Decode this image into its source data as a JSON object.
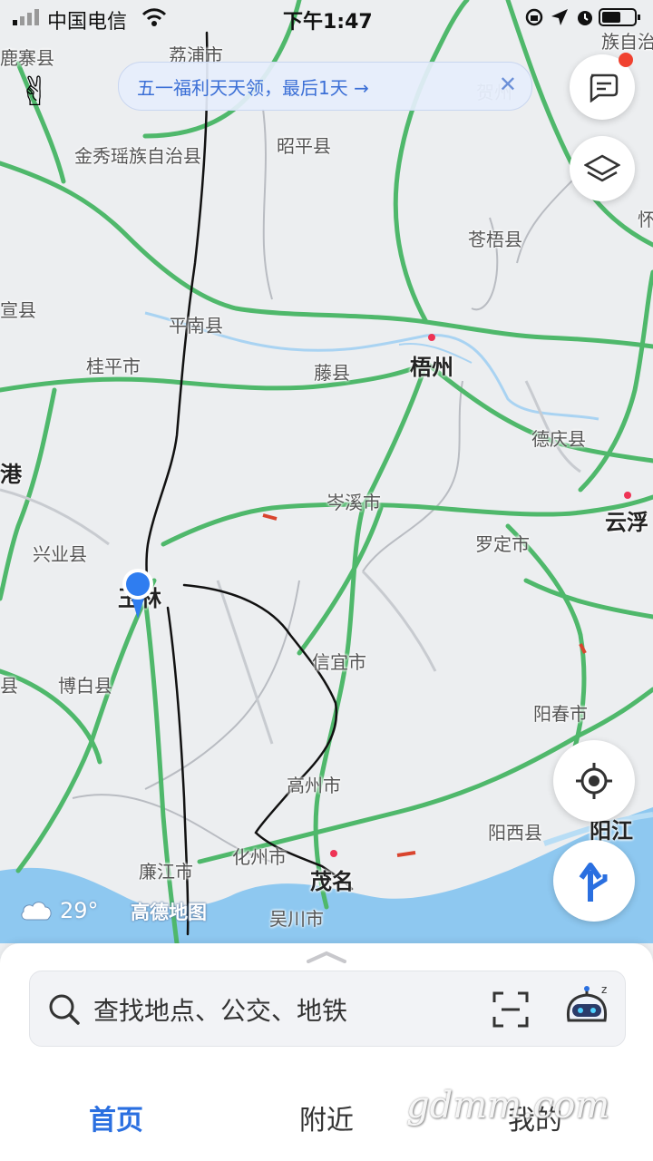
{
  "status_bar": {
    "carrier": "中国电信",
    "time": "下午1:47"
  },
  "banner": {
    "text": "五一福利天天领，最后1天 →",
    "close": "✕"
  },
  "map": {
    "places": [
      {
        "name": "鹿寨县"
      },
      {
        "name": "荔浦市"
      },
      {
        "name": "族自治"
      },
      {
        "name": "贺州"
      },
      {
        "name": "金秀瑶族自治县"
      },
      {
        "name": "昭平县"
      },
      {
        "name": "苍梧县"
      },
      {
        "name": "怀"
      },
      {
        "name": "宣县"
      },
      {
        "name": "平南县"
      },
      {
        "name": "桂平市"
      },
      {
        "name": "藤县"
      },
      {
        "name": "梧州"
      },
      {
        "name": "德庆县"
      },
      {
        "name": "港"
      },
      {
        "name": "岑溪市"
      },
      {
        "name": "云浮"
      },
      {
        "name": "兴业县"
      },
      {
        "name": "罗定市"
      },
      {
        "name": "玉林"
      },
      {
        "name": "信宜市"
      },
      {
        "name": "县"
      },
      {
        "name": "博白县"
      },
      {
        "name": "阳春市"
      },
      {
        "name": "高州市"
      },
      {
        "name": "阳西县"
      },
      {
        "name": "阳江"
      },
      {
        "name": "化州市"
      },
      {
        "name": "廉江市"
      },
      {
        "name": "茂名"
      },
      {
        "name": "吴川市"
      }
    ],
    "logo": "高德地图",
    "weather": "29°"
  },
  "bottom_sheet": {
    "search_placeholder": "查找地点、公交、地铁",
    "tabs": [
      "首页",
      "附近",
      "我的"
    ]
  },
  "watermark": "gdmm.com",
  "colors": {
    "accent": "#2a6fe0",
    "road_green": "#4fb86b",
    "sea": "#8ec8f0",
    "location_dot": "#2f7df0"
  }
}
